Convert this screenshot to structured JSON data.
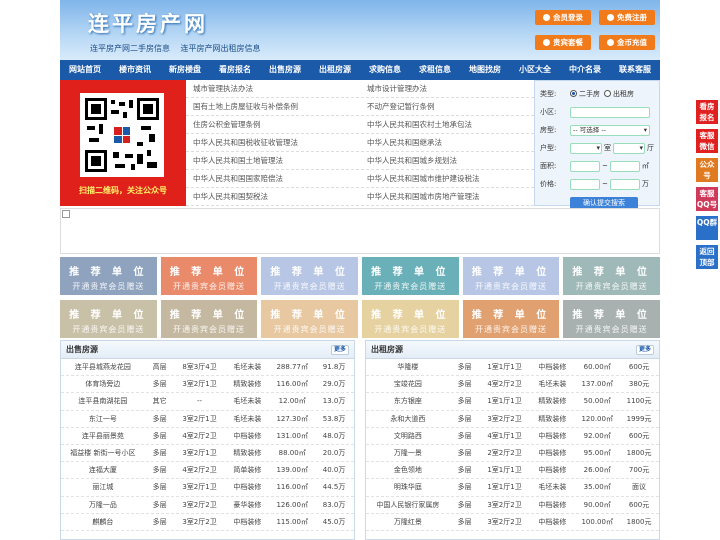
{
  "header": {
    "logo": "连平房产网",
    "slogan": "连平房产网二手房信息 连平房产网出租房信息",
    "buttons": [
      "会员登录",
      "免费注册",
      "贵宾套餐",
      "金币充值"
    ]
  },
  "nav": [
    "网站首页",
    "楼市资讯",
    "新房楼盘",
    "看房报名",
    "出售房源",
    "出租房源",
    "求购信息",
    "求租信息",
    "地图找房",
    "小区大全",
    "中介名录",
    "联系客服"
  ],
  "qr": {
    "caption": "扫描二维码，关注公众号"
  },
  "laws": [
    [
      "城市管理执法办法",
      "城市设计管理办法"
    ],
    [
      "国有土地上房屋征收与补偿条例",
      "不动产登记暂行条例"
    ],
    [
      "住房公积金管理条例",
      "中华人民共和国农村土地承包法"
    ],
    [
      "中华人民共和国税收征收管理法",
      "中华人民共和国继承法"
    ],
    [
      "中华人民共和国土地管理法",
      "中华人民共和国城乡规划法"
    ],
    [
      "中华人民共和国国家赔偿法",
      "中华人民共和国城市维护建设税法"
    ],
    [
      "中华人民共和国契税法",
      "中华人民共和国城市房地产管理法"
    ]
  ],
  "search": {
    "type_label": "类型:",
    "type_options": [
      "二手房",
      "出租房"
    ],
    "community_label": "小区:",
    "house_type_label": "房型:",
    "house_type_value": "-- 可选择 --",
    "layout_label": "户型:",
    "room_unit": "室",
    "hall_unit": "厅",
    "area_label": "面积:",
    "area_unit": "㎡",
    "price_label": "价格:",
    "price_unit": "万",
    "submit": "确认提交搜索"
  },
  "ad": {
    "line1": "推 荐 单 位",
    "line2": "开通贵宾会员赠送"
  },
  "ad_colors": [
    "#8fa3bf",
    "#e98a6a",
    "#b8c6e6",
    "#6ab0b8",
    "#b8c6e6",
    "#9fb8b8",
    "#c9c0a8",
    "#c4b8a0",
    "#e8c8a0",
    "#e6d2a0",
    "#e0a070",
    "#a8b0b0"
  ],
  "sale": {
    "title": "出售房源",
    "more": "更多",
    "rows": [
      [
        "连平县城燕龙花园",
        "高层",
        "8室3厅4卫",
        "毛坯未装",
        "288.77㎡",
        "91.8万"
      ],
      [
        "体育场旁边",
        "多层",
        "3室2厅1卫",
        "精致装修",
        "116.00㎡",
        "29.0万"
      ],
      [
        "连平县南湖花园",
        "其它",
        "--",
        "毛坯未装",
        "12.00㎡",
        "13.0万"
      ],
      [
        "东江一号",
        "多层",
        "3室2厅1卫",
        "毛坯未装",
        "127.30㎡",
        "53.8万"
      ],
      [
        "连平县丽景苑",
        "多层",
        "4室2厅2卫",
        "中档装修",
        "131.00㎡",
        "48.0万"
      ],
      [
        "福益楼 新街一号小区",
        "多层",
        "3室2厅1卫",
        "精致装修",
        "88.00㎡",
        "20.0万"
      ],
      [
        "连福大厦",
        "多层",
        "4室2厅2卫",
        "简单装修",
        "139.00㎡",
        "40.0万"
      ],
      [
        "丽江城",
        "多层",
        "3室2厅1卫",
        "中档装修",
        "116.00㎡",
        "44.5万"
      ],
      [
        "万隆一品",
        "多层",
        "3室2厅2卫",
        "豪华装修",
        "126.00㎡",
        "83.0万"
      ],
      [
        "麒麟台",
        "多层",
        "3室2厅2卫",
        "中档装修",
        "115.00㎡",
        "45.0万"
      ]
    ]
  },
  "rent": {
    "title": "出租房源",
    "more": "更多",
    "rows": [
      [
        "华隆楼",
        "多层",
        "1室1厅1卫",
        "中档装修",
        "60.00㎡",
        "600元"
      ],
      [
        "宝竣花园",
        "多层",
        "4室2厅2卫",
        "毛坯未装",
        "137.00㎡",
        "380元"
      ],
      [
        "东方银座",
        "多层",
        "1室1厅1卫",
        "精致装修",
        "50.00㎡",
        "1100元"
      ],
      [
        "永和大道西",
        "多层",
        "3室2厅2卫",
        "精致装修",
        "120.00㎡",
        "1999元"
      ],
      [
        "文明路西",
        "多层",
        "4室1厅1卫",
        "中档装修",
        "92.00㎡",
        "600元"
      ],
      [
        "万隆一景",
        "多层",
        "2室2厅2卫",
        "中档装修",
        "95.00㎡",
        "1800元"
      ],
      [
        "金色领地",
        "多层",
        "1室1厅1卫",
        "中档装修",
        "26.00㎡",
        "700元"
      ],
      [
        "明珠华庭",
        "多层",
        "1室1厅1卫",
        "毛坯未装",
        "35.00㎡",
        "面议"
      ],
      [
        "中国人民银行家属房",
        "多层",
        "3室2厅2卫",
        "中档装修",
        "90.00㎡",
        "600元"
      ],
      [
        "万隆红景",
        "多层",
        "3室2厅2卫",
        "中档装修",
        "100.00㎡",
        "1800元"
      ]
    ]
  },
  "float": [
    {
      "label": "看房报名",
      "color": "#e02020"
    },
    {
      "label": "客服微信",
      "color": "#e02020"
    },
    {
      "label": "公众号",
      "color": "#e07a20"
    },
    {
      "label": "客服QQ号",
      "color": "#d03a5a"
    },
    {
      "label": "QQ群",
      "color": "#2a6fc8"
    },
    {
      "label": "返回顶部",
      "color": "#2a6fc8"
    }
  ]
}
